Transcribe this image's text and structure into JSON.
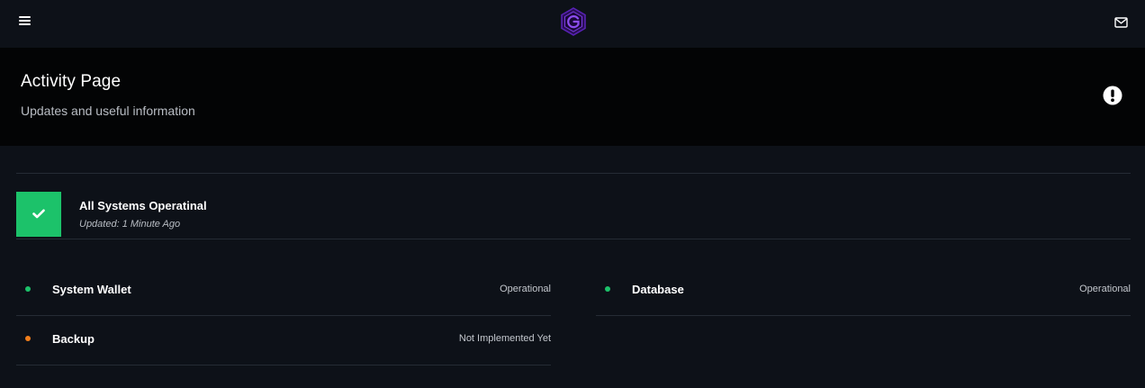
{
  "topbar": {
    "menu_icon": "hamburger-menu-icon",
    "logo_icon": "hexagon-logo-icon",
    "mail_icon": "envelope-icon"
  },
  "header": {
    "title": "Activity Page",
    "subtitle": "Updates and useful information",
    "alert_icon": "exclamation-circle-icon"
  },
  "summary": {
    "icon": "check-icon",
    "title": "All Systems Operatinal",
    "updated": "Updated: 1 Minute Ago"
  },
  "services": [
    {
      "name": "System Wallet",
      "status": "Operational",
      "status_color": "#1cc26a"
    },
    {
      "name": "Database",
      "status": "Operational",
      "status_color": "#1cc26a"
    },
    {
      "name": "Backup",
      "status": "Not Implemented Yet",
      "status_color": "#f07e1b"
    }
  ],
  "colors": {
    "background": "#0d1118",
    "header_band": "#030405",
    "success": "#1cc26a",
    "warning": "#f07e1b",
    "logo_accent": "#6a2bd0"
  }
}
